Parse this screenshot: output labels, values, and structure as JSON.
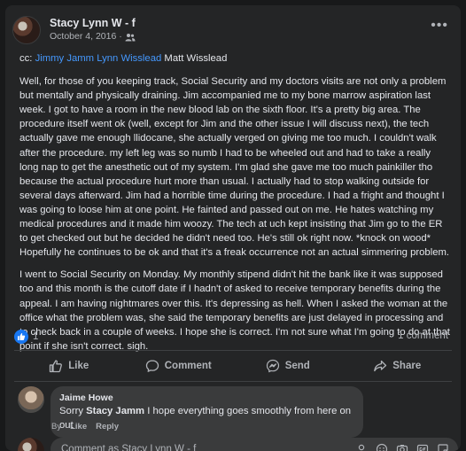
{
  "post": {
    "author": "Stacy Lynn W - f",
    "date": "October 4, 2016",
    "separator": "·",
    "audience_icon": "friends-icon",
    "more_icon": "more-horizontal-icon",
    "more_label": "•••",
    "cc_prefix": "cc:",
    "cc_links": "Jimmy Jamm Lynn Wisslead",
    "cc_plain": "Matt Wisslead",
    "paragraphs": [
      "Well, for those of you keeping track, Social Security and my doctors visits are not only a problem but mentally and physically draining.  Jim accompanied me to my bone marrow aspiration last week.  I got to have a room in the new blood lab on the sixth floor.  It's a pretty big area.  The procedure itself went ok (well, except for Jim and the other issue I will discuss next), the tech actually gave me enough llidocane, she actually verged on giving me too much.  I couldn't walk after the procedure.  my left leg was so numb I had to be wheeled out and had to take a really long nap to get the anesthetic out of my system. I'm glad she gave me too much painkiller tho because the actual procedure hurt more than usual.  I actually had to stop walking outside for several days afterward.  Jim had a horrible time during the procedure.  I had a fright and thought I was going to loose him at one point. He fainted and passed out on me.  He hates watching my medical procedures and it made him woozy. The tech at uch kept insisting that Jim go to the ER to get checked out but he decided he didn't need too.  He's still ok right now.  *knock on wood* Hopefully he continues to be ok and that it's a freak occurrence not an actual simmering problem.",
      "I went to Social Security on Monday.  My monthly stipend didn't hit the bank like it was supposed too and this month is the cutoff date if I hadn't of asked to receive temporary benefits during the appeal.  I am having nightmares over this.  It's depressing as hell. When I asked the woman at the office what the problem was, she said the temporary benefits are just delayed in processing and to check back in a couple of weeks. I hope she is correct.  I'm not sure what I'm going to do at that point if she isn't correct. sigh."
    ]
  },
  "reactions": {
    "icon": "like-icon",
    "count": "1",
    "comments_label": "1 comment"
  },
  "actions": {
    "like": "Like",
    "comment": "Comment",
    "send": "Send",
    "share": "Share"
  },
  "comment": {
    "author": "Jaime Howe",
    "prefix": "Sorry ",
    "mention": "Stacy Jamm",
    "text": " I hope everything goes smoothly from here on out",
    "by_label": "By",
    "like_label": "Like",
    "reply_label": "Reply"
  },
  "composer": {
    "placeholder": "Comment as Stacy Lynn W - f",
    "icons": [
      "avatar-sticker-icon",
      "emoji-icon",
      "camera-icon",
      "gif-icon",
      "sticker-icon"
    ]
  },
  "colors": {
    "background": "#18191a",
    "card": "#242526",
    "bubble": "#3a3b3c",
    "link": "#4599ff",
    "like_blue": "#1877f2"
  }
}
